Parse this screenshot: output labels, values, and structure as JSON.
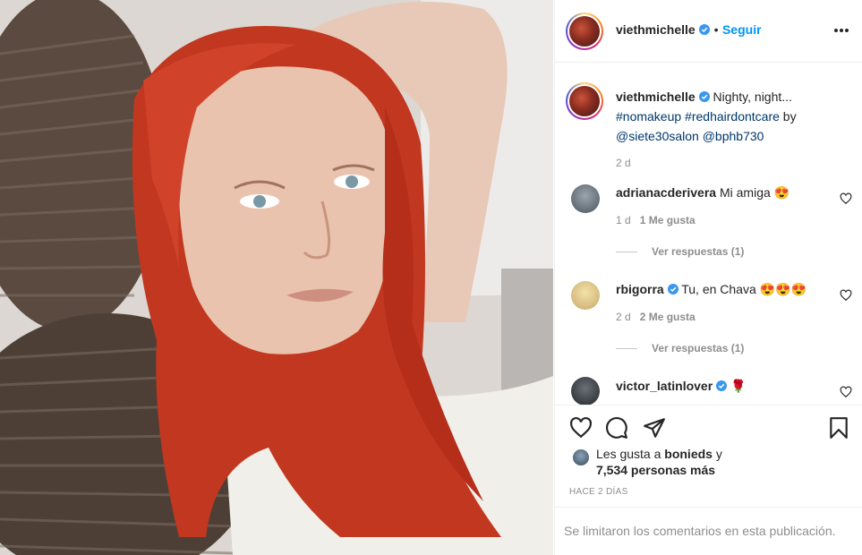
{
  "post": {
    "username": "viethmichelle",
    "follow_label": "Seguir",
    "separator": "•",
    "caption_text": "Nighty, night...",
    "hashtags": "#nomakeup #redhairdontcare",
    "caption_by": "by",
    "mentions": "@siete30salon @bphb730",
    "caption_time": "2 d"
  },
  "comments": [
    {
      "username": "adrianacderivera",
      "text": "Mi amiga 😍",
      "time": "1 d",
      "likes": "1 Me gusta",
      "replies": "Ver respuestas (1)"
    },
    {
      "username": "rbigorra",
      "text": "Tu, en Chava 😍😍😍",
      "time": "2 d",
      "likes": "2 Me gusta",
      "replies": "Ver respuestas (1)"
    },
    {
      "username": "victor_latinlover",
      "text": "🌹"
    }
  ],
  "likes": {
    "line1_prefix": "Les gusta a",
    "liker": "bonieds",
    "line1_suffix": "y",
    "line2": "7,534 personas más"
  },
  "timestamp": "HACE 2 DÍAS",
  "comments_limited": "Se limitaron los comentarios en esta publicación.",
  "colors": {
    "link": "#0095f6",
    "tag": "#00376b",
    "muted": "#8e8e8e",
    "verified": "#3897f0"
  },
  "icons": [
    "more-options-icon",
    "verified-icon",
    "heart-icon",
    "comment-icon",
    "share-icon",
    "save-icon"
  ]
}
